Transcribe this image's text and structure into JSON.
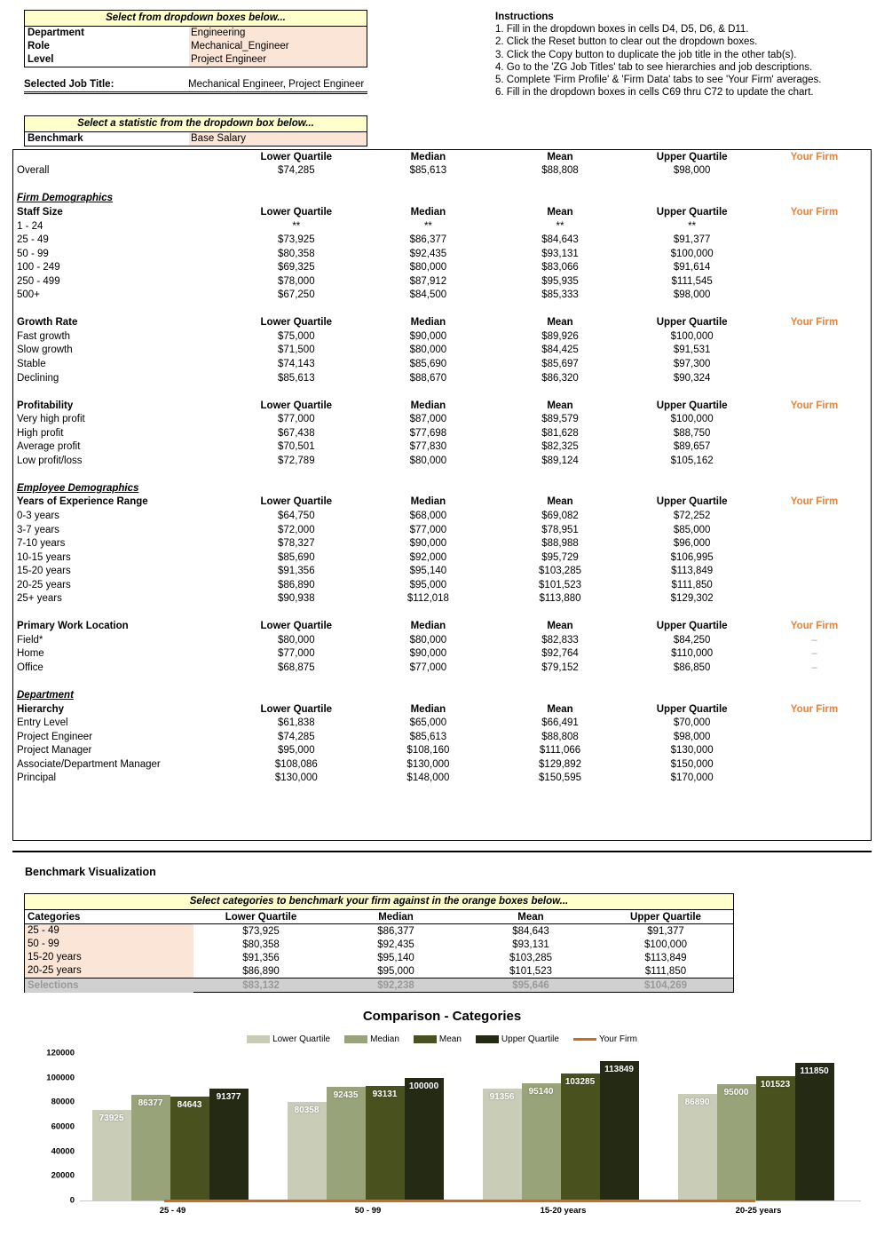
{
  "selectors": {
    "dropdown_title": "Select from dropdown boxes below...",
    "rows": [
      {
        "label": "Department",
        "value": "Engineering"
      },
      {
        "label": "Role",
        "value": "Mechanical_Engineer"
      },
      {
        "label": "Level",
        "value": "Project Engineer"
      }
    ],
    "selected_job_label": "Selected Job Title:",
    "selected_job_value": "Mechanical Engineer, Project Engineer",
    "benchmark_title": "Select a statistic from the dropdown box below...",
    "benchmark_label": "Benchmark",
    "benchmark_value": "Base Salary"
  },
  "instructions": {
    "heading": "Instructions",
    "items": [
      "1. Fill in the dropdown boxes in cells D4, D5, D6, & D11.",
      "2. Click the Reset button to clear out the dropdown boxes.",
      "3. Click the Copy button to duplicate the job title in the other tab(s).",
      "4. Go to the 'ZG Job Titles' tab to see hierarchies and job descriptions.",
      "5. Complete 'Firm Profile' & 'Firm Data' tabs to see 'Your Firm' averages.",
      "6. Fill in the dropdown boxes in cells C69 thru C72 to update the chart."
    ]
  },
  "columns": [
    "Lower Quartile",
    "Median",
    "Mean",
    "Upper Quartile",
    "Your Firm"
  ],
  "main_table": {
    "overall": {
      "header": [
        "",
        "Lower Quartile",
        "Median",
        "Mean",
        "Upper Quartile",
        "Your Firm"
      ],
      "row": [
        "Overall",
        "$74,285",
        "$85,613",
        "$88,808",
        "$98,000",
        ""
      ]
    },
    "sections": [
      {
        "group": "Firm Demographics",
        "title": "Staff Size",
        "rows": [
          [
            "1 - 24",
            "**",
            "**",
            "**",
            "**",
            ""
          ],
          [
            "25 - 49",
            "$73,925",
            "$86,377",
            "$84,643",
            "$91,377",
            ""
          ],
          [
            "50 - 99",
            "$80,358",
            "$92,435",
            "$93,131",
            "$100,000",
            ""
          ],
          [
            "100 - 249",
            "$69,325",
            "$80,000",
            "$83,066",
            "$91,614",
            ""
          ],
          [
            "250 - 499",
            "$78,000",
            "$87,912",
            "$95,935",
            "$111,545",
            ""
          ],
          [
            "500+",
            "$67,250",
            "$84,500",
            "$85,333",
            "$98,000",
            ""
          ]
        ]
      },
      {
        "group": "",
        "title": "Growth Rate",
        "rows": [
          [
            "Fast growth",
            "$75,000",
            "$90,000",
            "$89,926",
            "$100,000",
            ""
          ],
          [
            "Slow growth",
            "$71,500",
            "$80,000",
            "$84,425",
            "$91,531",
            ""
          ],
          [
            "Stable",
            "$74,143",
            "$85,690",
            "$85,697",
            "$97,300",
            ""
          ],
          [
            "Declining",
            "$85,613",
            "$88,670",
            "$86,320",
            "$90,324",
            ""
          ]
        ]
      },
      {
        "group": "",
        "title": "Profitability",
        "rows": [
          [
            "Very high profit",
            "$77,000",
            "$87,000",
            "$89,579",
            "$100,000",
            ""
          ],
          [
            "High profit",
            "$67,438",
            "$77,698",
            "$81,628",
            "$88,750",
            ""
          ],
          [
            "Average profit",
            "$70,501",
            "$77,830",
            "$82,325",
            "$89,657",
            ""
          ],
          [
            "Low profit/loss",
            "$72,789",
            "$80,000",
            "$89,124",
            "$105,162",
            ""
          ]
        ]
      },
      {
        "group": "Employee Demographics",
        "title": "Years of Experience Range",
        "rows": [
          [
            "0-3 years",
            "$64,750",
            "$68,000",
            "$69,082",
            "$72,252",
            ""
          ],
          [
            "3-7 years",
            "$72,000",
            "$77,000",
            "$78,951",
            "$85,000",
            ""
          ],
          [
            "7-10 years",
            "$78,327",
            "$90,000",
            "$88,988",
            "$96,000",
            ""
          ],
          [
            "10-15 years",
            "$85,690",
            "$92,000",
            "$95,729",
            "$106,995",
            ""
          ],
          [
            "15-20 years",
            "$91,356",
            "$95,140",
            "$103,285",
            "$113,849",
            ""
          ],
          [
            "20-25 years",
            "$86,890",
            "$95,000",
            "$101,523",
            "$111,850",
            ""
          ],
          [
            "25+ years",
            "$90,938",
            "$112,018",
            "$113,880",
            "$129,302",
            ""
          ]
        ]
      },
      {
        "group": "",
        "title": "Primary Work Location",
        "rows": [
          [
            "Field*",
            "$80,000",
            "$80,000",
            "$82,833",
            "$84,250",
            "–"
          ],
          [
            "Home",
            "$77,000",
            "$90,000",
            "$92,764",
            "$110,000",
            "–"
          ],
          [
            "Office",
            "$68,875",
            "$77,000",
            "$79,152",
            "$86,850",
            "–"
          ]
        ]
      },
      {
        "group": "Department",
        "title": "Hierarchy",
        "rows": [
          [
            "Entry Level",
            "$61,838",
            "$65,000",
            "$66,491",
            "$70,000",
            ""
          ],
          [
            "Project Engineer",
            "$74,285",
            "$85,613",
            "$88,808",
            "$98,000",
            ""
          ],
          [
            "Project Manager",
            "$95,000",
            "$108,160",
            "$111,066",
            "$130,000",
            ""
          ],
          [
            "Associate/Department Manager",
            "$108,086",
            "$130,000",
            "$129,892",
            "$150,000",
            ""
          ],
          [
            "Principal",
            "$130,000",
            "$148,000",
            "$150,595",
            "$170,000",
            ""
          ]
        ]
      }
    ]
  },
  "benchmark_viz": {
    "title": "Benchmark Visualization",
    "banner": "Select categories to benchmark your firm against in the orange boxes below...",
    "headers": [
      "Categories",
      "Lower Quartile",
      "Median",
      "Mean",
      "Upper Quartile"
    ],
    "rows": [
      [
        "25 - 49",
        "$73,925",
        "$86,377",
        "$84,643",
        "$91,377"
      ],
      [
        "50 - 99",
        "$80,358",
        "$92,435",
        "$93,131",
        "$100,000"
      ],
      [
        "15-20 years",
        "$91,356",
        "$95,140",
        "$103,285",
        "$113,849"
      ],
      [
        "20-25 years",
        "$86,890",
        "$95,000",
        "$101,523",
        "$111,850"
      ]
    ],
    "selections_row": [
      "Selections",
      "$83,132",
      "$92,238",
      "$95,646",
      "$104,269"
    ]
  },
  "chart_data": {
    "type": "bar",
    "title": "Comparison - Categories",
    "categories": [
      "25 - 49",
      "50 - 99",
      "15-20 years",
      "20-25 years"
    ],
    "series": [
      {
        "name": "Lower Quartile",
        "color": "#c9cdb8",
        "values": [
          73925,
          80358,
          91356,
          86890
        ]
      },
      {
        "name": "Median",
        "color": "#99a379",
        "values": [
          86377,
          92435,
          95140,
          95000
        ]
      },
      {
        "name": "Mean",
        "color": "#49521f",
        "values": [
          84643,
          93131,
          103285,
          101523
        ]
      },
      {
        "name": "Upper Quartile",
        "color": "#242a14",
        "values": [
          91377,
          100000,
          113849,
          111850
        ]
      },
      {
        "name": "Your Firm",
        "color": "#d2691e",
        "values": [
          0,
          0,
          0,
          0
        ]
      }
    ],
    "ylabel": "",
    "xlabel": "",
    "ylim": [
      0,
      120000
    ],
    "yticks": [
      0,
      20000,
      40000,
      60000,
      80000,
      100000,
      120000
    ],
    "grid": false,
    "legend_position": "top"
  },
  "colors": {
    "accent_orange": "#e8833a",
    "banner_yellow": "#ffffcc",
    "input_peach": "#fbe5d6",
    "selections_gray": "#d0d0d0"
  }
}
